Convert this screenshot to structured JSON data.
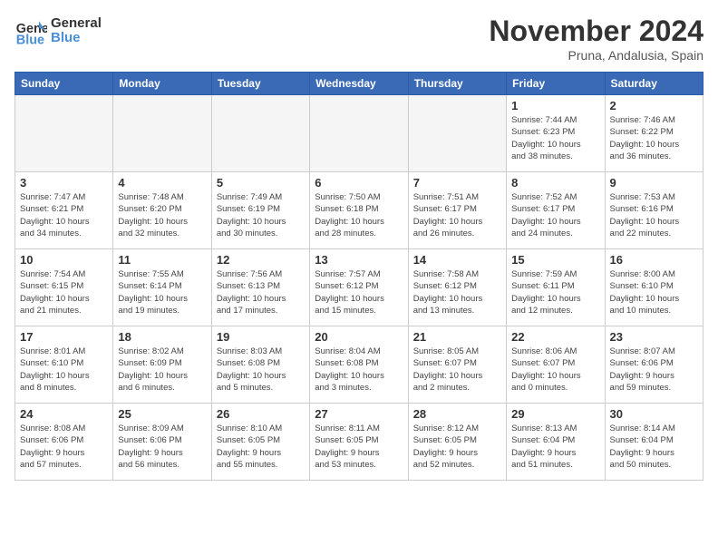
{
  "logo": {
    "line1": "General",
    "line2": "Blue"
  },
  "title": "November 2024",
  "location": "Pruna, Andalusia, Spain",
  "weekdays": [
    "Sunday",
    "Monday",
    "Tuesday",
    "Wednesday",
    "Thursday",
    "Friday",
    "Saturday"
  ],
  "weeks": [
    [
      {
        "day": "",
        "info": ""
      },
      {
        "day": "",
        "info": ""
      },
      {
        "day": "",
        "info": ""
      },
      {
        "day": "",
        "info": ""
      },
      {
        "day": "",
        "info": ""
      },
      {
        "day": "1",
        "info": "Sunrise: 7:44 AM\nSunset: 6:23 PM\nDaylight: 10 hours\nand 38 minutes."
      },
      {
        "day": "2",
        "info": "Sunrise: 7:46 AM\nSunset: 6:22 PM\nDaylight: 10 hours\nand 36 minutes."
      }
    ],
    [
      {
        "day": "3",
        "info": "Sunrise: 7:47 AM\nSunset: 6:21 PM\nDaylight: 10 hours\nand 34 minutes."
      },
      {
        "day": "4",
        "info": "Sunrise: 7:48 AM\nSunset: 6:20 PM\nDaylight: 10 hours\nand 32 minutes."
      },
      {
        "day": "5",
        "info": "Sunrise: 7:49 AM\nSunset: 6:19 PM\nDaylight: 10 hours\nand 30 minutes."
      },
      {
        "day": "6",
        "info": "Sunrise: 7:50 AM\nSunset: 6:18 PM\nDaylight: 10 hours\nand 28 minutes."
      },
      {
        "day": "7",
        "info": "Sunrise: 7:51 AM\nSunset: 6:17 PM\nDaylight: 10 hours\nand 26 minutes."
      },
      {
        "day": "8",
        "info": "Sunrise: 7:52 AM\nSunset: 6:17 PM\nDaylight: 10 hours\nand 24 minutes."
      },
      {
        "day": "9",
        "info": "Sunrise: 7:53 AM\nSunset: 6:16 PM\nDaylight: 10 hours\nand 22 minutes."
      }
    ],
    [
      {
        "day": "10",
        "info": "Sunrise: 7:54 AM\nSunset: 6:15 PM\nDaylight: 10 hours\nand 21 minutes."
      },
      {
        "day": "11",
        "info": "Sunrise: 7:55 AM\nSunset: 6:14 PM\nDaylight: 10 hours\nand 19 minutes."
      },
      {
        "day": "12",
        "info": "Sunrise: 7:56 AM\nSunset: 6:13 PM\nDaylight: 10 hours\nand 17 minutes."
      },
      {
        "day": "13",
        "info": "Sunrise: 7:57 AM\nSunset: 6:12 PM\nDaylight: 10 hours\nand 15 minutes."
      },
      {
        "day": "14",
        "info": "Sunrise: 7:58 AM\nSunset: 6:12 PM\nDaylight: 10 hours\nand 13 minutes."
      },
      {
        "day": "15",
        "info": "Sunrise: 7:59 AM\nSunset: 6:11 PM\nDaylight: 10 hours\nand 12 minutes."
      },
      {
        "day": "16",
        "info": "Sunrise: 8:00 AM\nSunset: 6:10 PM\nDaylight: 10 hours\nand 10 minutes."
      }
    ],
    [
      {
        "day": "17",
        "info": "Sunrise: 8:01 AM\nSunset: 6:10 PM\nDaylight: 10 hours\nand 8 minutes."
      },
      {
        "day": "18",
        "info": "Sunrise: 8:02 AM\nSunset: 6:09 PM\nDaylight: 10 hours\nand 6 minutes."
      },
      {
        "day": "19",
        "info": "Sunrise: 8:03 AM\nSunset: 6:08 PM\nDaylight: 10 hours\nand 5 minutes."
      },
      {
        "day": "20",
        "info": "Sunrise: 8:04 AM\nSunset: 6:08 PM\nDaylight: 10 hours\nand 3 minutes."
      },
      {
        "day": "21",
        "info": "Sunrise: 8:05 AM\nSunset: 6:07 PM\nDaylight: 10 hours\nand 2 minutes."
      },
      {
        "day": "22",
        "info": "Sunrise: 8:06 AM\nSunset: 6:07 PM\nDaylight: 10 hours\nand 0 minutes."
      },
      {
        "day": "23",
        "info": "Sunrise: 8:07 AM\nSunset: 6:06 PM\nDaylight: 9 hours\nand 59 minutes."
      }
    ],
    [
      {
        "day": "24",
        "info": "Sunrise: 8:08 AM\nSunset: 6:06 PM\nDaylight: 9 hours\nand 57 minutes."
      },
      {
        "day": "25",
        "info": "Sunrise: 8:09 AM\nSunset: 6:06 PM\nDaylight: 9 hours\nand 56 minutes."
      },
      {
        "day": "26",
        "info": "Sunrise: 8:10 AM\nSunset: 6:05 PM\nDaylight: 9 hours\nand 55 minutes."
      },
      {
        "day": "27",
        "info": "Sunrise: 8:11 AM\nSunset: 6:05 PM\nDaylight: 9 hours\nand 53 minutes."
      },
      {
        "day": "28",
        "info": "Sunrise: 8:12 AM\nSunset: 6:05 PM\nDaylight: 9 hours\nand 52 minutes."
      },
      {
        "day": "29",
        "info": "Sunrise: 8:13 AM\nSunset: 6:04 PM\nDaylight: 9 hours\nand 51 minutes."
      },
      {
        "day": "30",
        "info": "Sunrise: 8:14 AM\nSunset: 6:04 PM\nDaylight: 9 hours\nand 50 minutes."
      }
    ]
  ]
}
